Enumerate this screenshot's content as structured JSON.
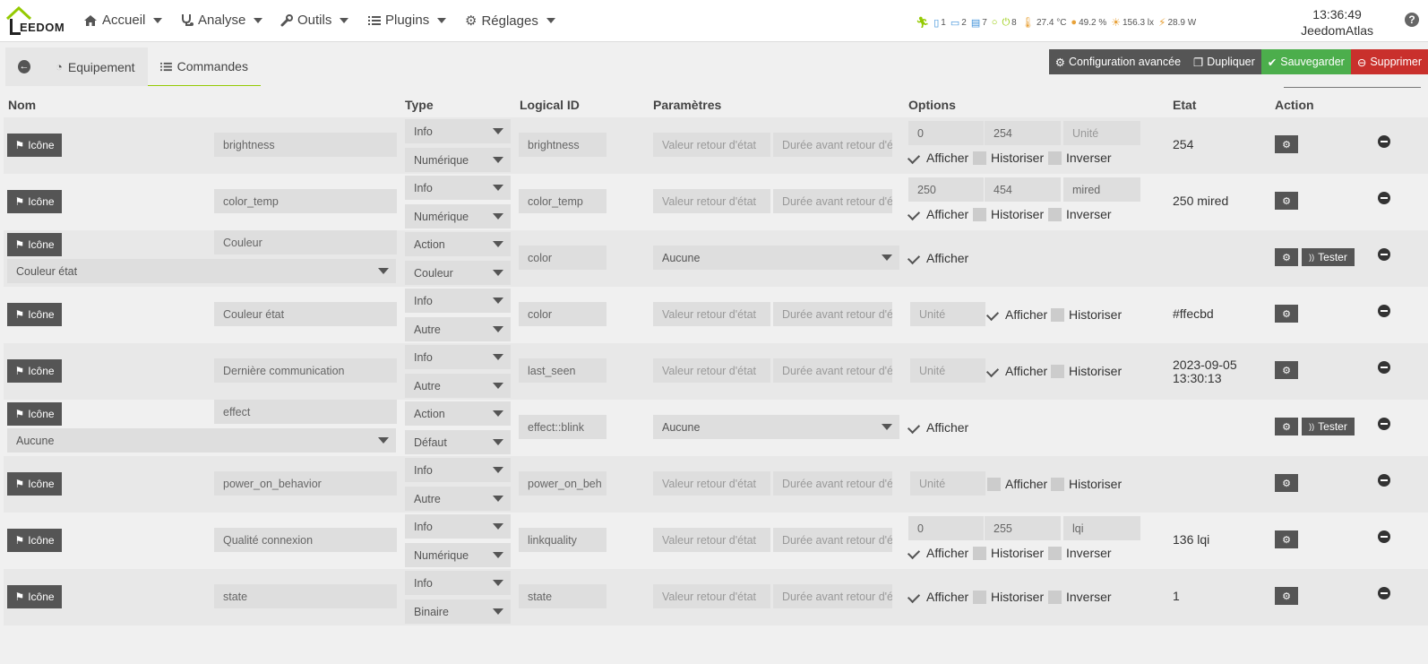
{
  "nav": {
    "logo_text": "EEDOM",
    "items": [
      {
        "label": "Accueil",
        "icon": "home-icon"
      },
      {
        "label": "Analyse",
        "icon": "stethoscope-icon"
      },
      {
        "label": "Outils",
        "icon": "wrench-icon"
      },
      {
        "label": "Plugins",
        "icon": "list-icon"
      },
      {
        "label": "Réglages",
        "icon": "gear-icon"
      }
    ],
    "status": {
      "doors": "1",
      "windows": "2",
      "shutters": "7",
      "lights": "8",
      "temperature": "27.4 °C",
      "humidity": "49.2 %",
      "luminosity": "156.3 lx",
      "power": "28.9 W"
    },
    "time": "13:36:49",
    "hostname": "JeedomAtlas",
    "help": "?"
  },
  "tabs": [
    {
      "label": ""
    },
    {
      "label": "Equipement"
    },
    {
      "label": "Commandes"
    }
  ],
  "actions": {
    "config": "Configuration avancée",
    "duplicate": "Dupliquer",
    "save": "Sauvegarder",
    "delete": "Supprimer"
  },
  "columns": {
    "nom": "Nom",
    "type": "Type",
    "logical_id": "Logical ID",
    "params": "Paramètres",
    "options": "Options",
    "etat": "Etat",
    "action": "Action"
  },
  "labels": {
    "icone": "Icône",
    "afficher": "Afficher",
    "historiser": "Historiser",
    "inverser": "Inverser",
    "tester": "Tester",
    "ph_valeur_retour": "Valeur retour d'état",
    "ph_duree": "Durée avant retour d'é",
    "ph_unite": "Unité"
  },
  "rows": [
    {
      "name": "brightness",
      "type": "Info",
      "subtype": "Numérique",
      "logical_id": "brightness",
      "min": "0",
      "max": "254",
      "unit": "",
      "etat": "254"
    },
    {
      "name": "color_temp",
      "type": "Info",
      "subtype": "Numérique",
      "logical_id": "color_temp",
      "min": "250",
      "max": "454",
      "unit": "mired",
      "etat": "250 mired"
    },
    {
      "name": "Couleur",
      "type": "Action",
      "subtype": "Couleur",
      "logical_id": "color",
      "linked": "Couleur état",
      "param": "Aucune"
    },
    {
      "name": "Couleur état",
      "type": "Info",
      "subtype": "Autre",
      "logical_id": "color",
      "etat": "#ffecbd"
    },
    {
      "name": "Dernière communication",
      "type": "Info",
      "subtype": "Autre",
      "logical_id": "last_seen",
      "etat_line1": "2023-09-05",
      "etat_line2": "13:30:13"
    },
    {
      "name": "effect",
      "type": "Action",
      "subtype": "Défaut",
      "logical_id": "effect::blink",
      "linked": "Aucune",
      "param": "Aucune"
    },
    {
      "name": "power_on_behavior",
      "type": "Info",
      "subtype": "Autre",
      "logical_id": "power_on_beh"
    },
    {
      "name": "Qualité connexion",
      "type": "Info",
      "subtype": "Numérique",
      "logical_id": "linkquality",
      "min": "0",
      "max": "255",
      "unit": "lqi",
      "etat": "136 lqi"
    },
    {
      "name": "state",
      "type": "Info",
      "subtype": "Binaire",
      "logical_id": "state",
      "etat": "1"
    }
  ]
}
